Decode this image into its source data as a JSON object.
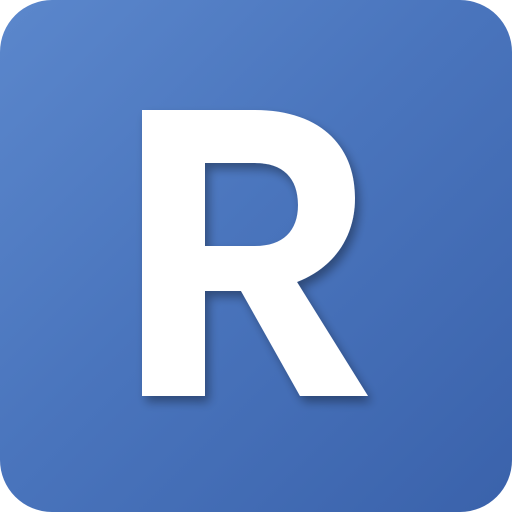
{
  "icon": {
    "letter": "R",
    "background_start": "#5b87cc",
    "background_end": "#3a62ab",
    "letter_color": "#ffffff"
  }
}
